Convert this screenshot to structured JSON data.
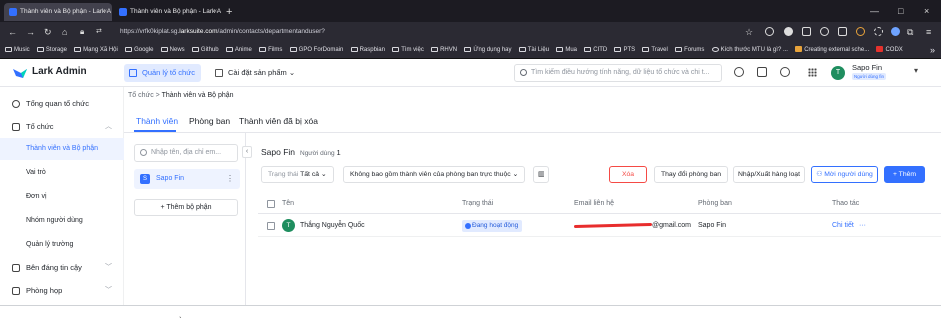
{
  "browser": {
    "tabs": [
      {
        "title": "Thành viên và Bộ phận - Lark A",
        "close": "×"
      },
      {
        "title": "Thành viên và Bộ phận - Lark A",
        "close": "×"
      }
    ],
    "new_tab": "+",
    "window_controls": [
      "—",
      "□",
      "×"
    ],
    "url_prefix": "https://vrfk0kiplat.sg.",
    "url_domain": "larksuite.com",
    "url_path": "/admin/contacts/departmentanduser?",
    "bookmarks": [
      "Music",
      "Storage",
      "Mạng Xã Hội",
      "Google",
      "News",
      "Github",
      "Anime",
      "Films",
      "GPO ForDomain",
      "Raspbian",
      "Tìm việc",
      "RHVN",
      "Ứng dụng hay",
      "Tài Liệu",
      "Mua",
      "CITD",
      "PTS",
      "Travel",
      "Forums",
      "Kích thước MTU là gì? ...",
      "Creating external sche...",
      "CODX"
    ],
    "bookmarks_more": "»"
  },
  "header": {
    "brand": "Lark Admin",
    "nav_org": "Quản lý tổ chức",
    "nav_settings": "Cài đặt sản phẩm",
    "search_placeholder": "Tìm kiếm điều hướng tính năng, dữ liệu tổ chức và chi t...",
    "user": {
      "initial": "T",
      "name": "Sapo Fin",
      "role": "Người dùng fin"
    }
  },
  "sidebar": {
    "overview": "Tổng quan tổ chức",
    "org": "Tổ chức",
    "org_items": [
      "Thành viên và Bộ phận",
      "Vai trò",
      "Đơn vị",
      "Nhóm người dùng",
      "Quản lý trường"
    ],
    "trusted": "Bên đáng tin cậy",
    "rooms": "Phòng họp"
  },
  "main": {
    "breadcrumb_root": "Tổ chức",
    "breadcrumb_sep": ">",
    "breadcrumb_current": "Thành viên và Bộ phận",
    "tabs": [
      "Thành viên",
      "Phòng ban",
      "Thành viên đã bị xóa"
    ]
  },
  "dept_panel": {
    "search_placeholder": "Nhập tên, địa chỉ em...",
    "dept_badge": "S",
    "dept_name": "Sapo Fin",
    "add_label": "+ Thêm bộ phận",
    "collapse": "‹"
  },
  "content": {
    "dept_title": "Sapo Fin",
    "count_label": "Người dùng",
    "count": "1",
    "filter_status_label": "Trạng thái",
    "filter_status_value": "Tất cả",
    "filter_scope": "Không bao gồm thành viên của phòng ban trực thuộc",
    "btn_delete": "Xóa",
    "btn_change_dept": "Thay đổi phòng ban",
    "btn_import_export": "Nhập/Xuất hàng loạt",
    "btn_invite": "Mời người dùng",
    "btn_add": "+ Thêm"
  },
  "table": {
    "columns": [
      "Tên",
      "Trạng thái",
      "Email liên hệ",
      "Phòng ban",
      "Thao tác"
    ],
    "rows": [
      {
        "initial": "T",
        "name": "Thắng Nguyễn Quốc",
        "status": "Đang hoạt động",
        "email_visible": "@gmail.com",
        "department": "Sapo Fin",
        "action_link": "Chi tiết",
        "more": "···"
      }
    ]
  },
  "stray_text": "`",
  "colors": {
    "accent": "#3370ff",
    "danger": "#f54a45",
    "avatar": "#1f8e5f",
    "redaction": "#e82d2d"
  }
}
